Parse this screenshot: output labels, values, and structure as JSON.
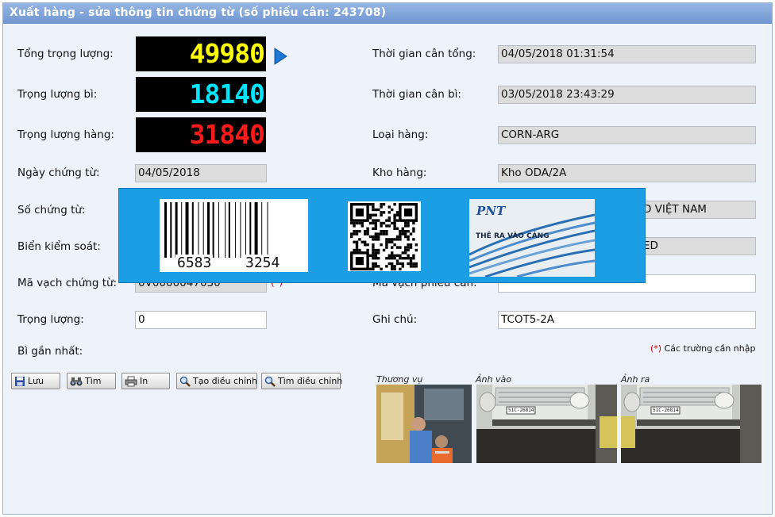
{
  "window": {
    "title": "Xuất hàng - sửa thông tin chứng từ (số phiếu cân: 243708)"
  },
  "left": {
    "gross_label": "Tổng trọng lượng:",
    "gross_value": "49980",
    "tare_label": "Trọng lượng bì:",
    "tare_value": "18140",
    "net_label": "Trọng lượng hàng:",
    "net_value": "31840",
    "doc_date_label": "Ngày chứng từ:",
    "doc_date_value": "04/05/2018",
    "doc_no_label": "Số chứng từ:",
    "plate_label": "Biển kiểm soát:",
    "barcode_label": "Mã vạch chứng từ:",
    "barcode_value": "0V0000047030",
    "required_mark": "(*)",
    "weight_label": "Trọng lượng:",
    "weight_value": "0",
    "last_tare_label": "Bì gần nhất:"
  },
  "right": {
    "gross_time_label": "Thời gian cân tổng:",
    "gross_time_value": "04/05/2018 01:31:54",
    "tare_time_label": "Thời gian cân bì:",
    "tare_time_value": "03/05/2018 23:43:29",
    "goods_type_label": "Loại hàng:",
    "goods_type_value": "CORN-ARG",
    "warehouse_label": "Kho hàng:",
    "warehouse_value": "Kho ODA/2A",
    "customer_value": "D VIỆT NAM",
    "status_value": "ED",
    "ticket_barcode_label": "Mã vạch phiếu cân:",
    "ticket_barcode_value": "",
    "note_label": "Ghi chú:",
    "note_value": "TCOT5-2A",
    "required_note_mark": "(*)",
    "required_note_text": "Các trường cần nhập"
  },
  "toolbar": {
    "save": "Lưu",
    "search": "Tìm",
    "print": "In",
    "create_adjust": "Tạo điều chỉnh",
    "find_adjust": "Tìm điều chỉnh"
  },
  "photos": {
    "trade_label": "Thương vụ",
    "in_label": "Ảnh vào",
    "out_label": "Ảnh ra",
    "plate_text": "51C-26814"
  },
  "overlay": {
    "barcode_number_left": "6583",
    "barcode_number_right": "3254",
    "card_brand": "PNT",
    "card_text": "THẺ RA VÀO CẢNG"
  },
  "colors": {
    "gross_lcd": "#ffff00",
    "tare_lcd": "#00e5ff",
    "net_lcd": "#ff1a1a",
    "title_bar": "#7ba0d8",
    "overlay_blue": "#1b9ee3"
  }
}
